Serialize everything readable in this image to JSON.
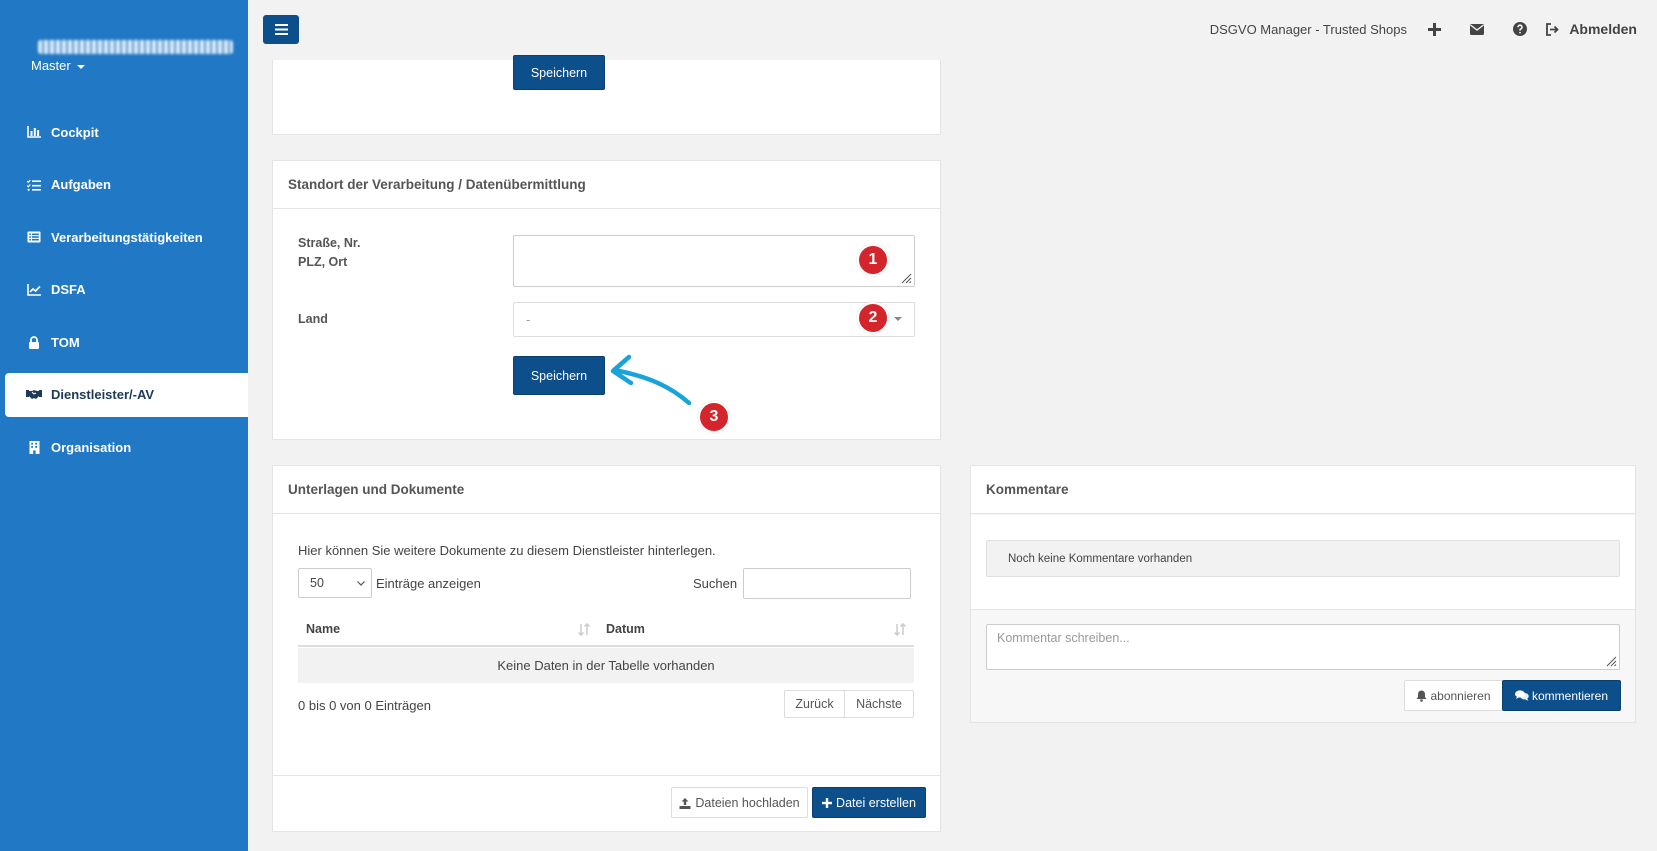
{
  "sidebar": {
    "master_label": "Master",
    "items": [
      {
        "label": "Cockpit",
        "icon": "chart-bar-icon"
      },
      {
        "label": "Aufgaben",
        "icon": "tasks-icon"
      },
      {
        "label": "Verarbeitungstätigkeiten",
        "icon": "list-alt-icon"
      },
      {
        "label": "DSFA",
        "icon": "chart-line-icon"
      },
      {
        "label": "TOM",
        "icon": "lock-icon"
      },
      {
        "label": "Dienstleister/-AV",
        "icon": "handshake-icon",
        "active": true
      },
      {
        "label": "Organisation",
        "icon": "building-icon"
      }
    ]
  },
  "topbar": {
    "title": "DSGVO Manager - Trusted Shops",
    "logout_label": "Abmelden"
  },
  "top_panel": {
    "save_label": "Speichern"
  },
  "location_panel": {
    "title": "Standort der Verarbeitung / Datenübermittlung",
    "street_label": "Straße, Nr.",
    "zip_label": "PLZ, Ort",
    "country_label": "Land",
    "country_value": "-",
    "save_label": "Speichern",
    "badges": [
      "1",
      "2",
      "3"
    ]
  },
  "documents_panel": {
    "title": "Unterlagen und Dokumente",
    "description": "Hier können Sie weitere Dokumente zu diesem Dienstleister hinterlegen.",
    "page_size": "50",
    "show_entries_label": "Einträge anzeigen",
    "search_label": "Suchen",
    "columns": [
      "Name",
      "Datum"
    ],
    "empty_text": "Keine Daten in der Tabelle vorhanden",
    "info_text": "0 bis 0 von 0 Einträgen",
    "prev_label": "Zurück",
    "next_label": "Nächste",
    "upload_label": "Dateien hochladen",
    "create_label": "Datei erstellen"
  },
  "comments_panel": {
    "title": "Kommentare",
    "empty_text": "Noch keine Kommentare vorhanden",
    "placeholder": "Kommentar schreiben...",
    "subscribe_label": "abonnieren",
    "comment_label": "kommentieren"
  },
  "colors": {
    "sidebar": "#2178c4",
    "primary": "#0d4f8b",
    "badge": "#d3252b",
    "arrow": "#1aa3d9"
  }
}
